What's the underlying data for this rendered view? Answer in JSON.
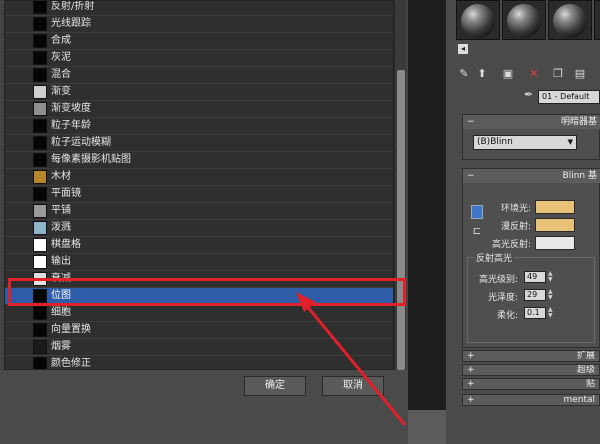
{
  "browser": {
    "items": [
      {
        "label": "反射/折射",
        "swatch": "#050505"
      },
      {
        "label": "光线跟踪",
        "swatch": "#050505"
      },
      {
        "label": "合成",
        "swatch": "#050505"
      },
      {
        "label": "灰泥",
        "swatch": "#050505"
      },
      {
        "label": "混合",
        "swatch": "#050505"
      },
      {
        "label": "渐变",
        "swatch": "#cfcfcf"
      },
      {
        "label": "渐变坡度",
        "swatch": "#8f8f8f"
      },
      {
        "label": "粒子年龄",
        "swatch": "#050505"
      },
      {
        "label": "粒子运动模糊",
        "swatch": "#050505"
      },
      {
        "label": "每像素摄影机贴图",
        "swatch": "#050505"
      },
      {
        "label": "木材",
        "swatch": "#b8862a"
      },
      {
        "label": "平面镜",
        "swatch": "#050505"
      },
      {
        "label": "平铺",
        "swatch": "#9a9a9a"
      },
      {
        "label": "泼溅",
        "swatch": "#8fb3c8"
      },
      {
        "label": "棋盘格",
        "swatch": "#ffffff"
      },
      {
        "label": "输出",
        "swatch": "#ffffff"
      },
      {
        "label": "衰减",
        "swatch": "#e0e0e0"
      },
      {
        "label": "位图",
        "swatch": "#050505"
      },
      {
        "label": "细胞",
        "swatch": "#050505"
      },
      {
        "label": "向量置换",
        "swatch": "#050505"
      },
      {
        "label": "烟雾",
        "swatch": "#1a1a1a"
      },
      {
        "label": "颜色修正",
        "swatch": "#050505"
      }
    ],
    "selected_index": 17,
    "ok_label": "确定",
    "cancel_label": "取消"
  },
  "editor": {
    "material_name": "01 - Default",
    "shader_rollout_title": "明暗器基",
    "shader_value": "(B)Blinn",
    "basic_rollout_title": "Blinn 基",
    "ambient_label": "环境光:",
    "diffuse_label": "漫反射:",
    "specular_label": "高光反射:",
    "ambient_color": "#e9c27a",
    "diffuse_color": "#e9c27a",
    "specular_color": "#e8e8e8",
    "specular_group_title": "反射高光",
    "spec_level_label": "高光级别:",
    "spec_level_value": "49",
    "glossiness_label": "光泽度:",
    "glossiness_value": "29",
    "soften_label": "柔化:",
    "soften_value": "0.1",
    "collapsed_rollouts": [
      "扩展",
      "超级",
      "贴",
      "mental"
    ]
  },
  "annotation_color": "#e0202a"
}
